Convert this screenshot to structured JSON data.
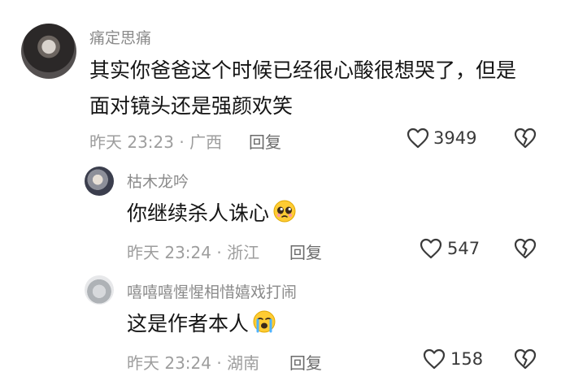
{
  "comments": [
    {
      "username": "痛定思痛",
      "content_line1": "其实你爸爸这个时候已经很心酸很想哭了，但是",
      "content_line2": "面对镜头还是强颜欢笑",
      "meta": "昨天 23:23 · 广西",
      "reply_label": "回复",
      "like_count": "3949",
      "avatar_icon": "avatar-doll",
      "replies": [
        {
          "username": "枯木龙吟",
          "content": "你继续杀人诛心",
          "emoji": "pleading-face-emoji",
          "meta": "昨天 23:24 · 浙江",
          "reply_label": "回复",
          "like_count": "547",
          "avatar_icon": "avatar-person"
        },
        {
          "username": "嘻嘻嘻惺惺相惜嬉戏打闹",
          "content": "这是作者本人",
          "emoji": "crying-face-emoji",
          "meta": "昨天 23:24 · 湖南",
          "reply_label": "回复",
          "like_count": "158",
          "avatar_icon": "avatar-cat"
        }
      ]
    }
  ],
  "colors": {
    "username": "#8b8b8b",
    "content": "#151515",
    "meta": "#9d9d9d",
    "icon_stroke": "#3a3a3a"
  }
}
